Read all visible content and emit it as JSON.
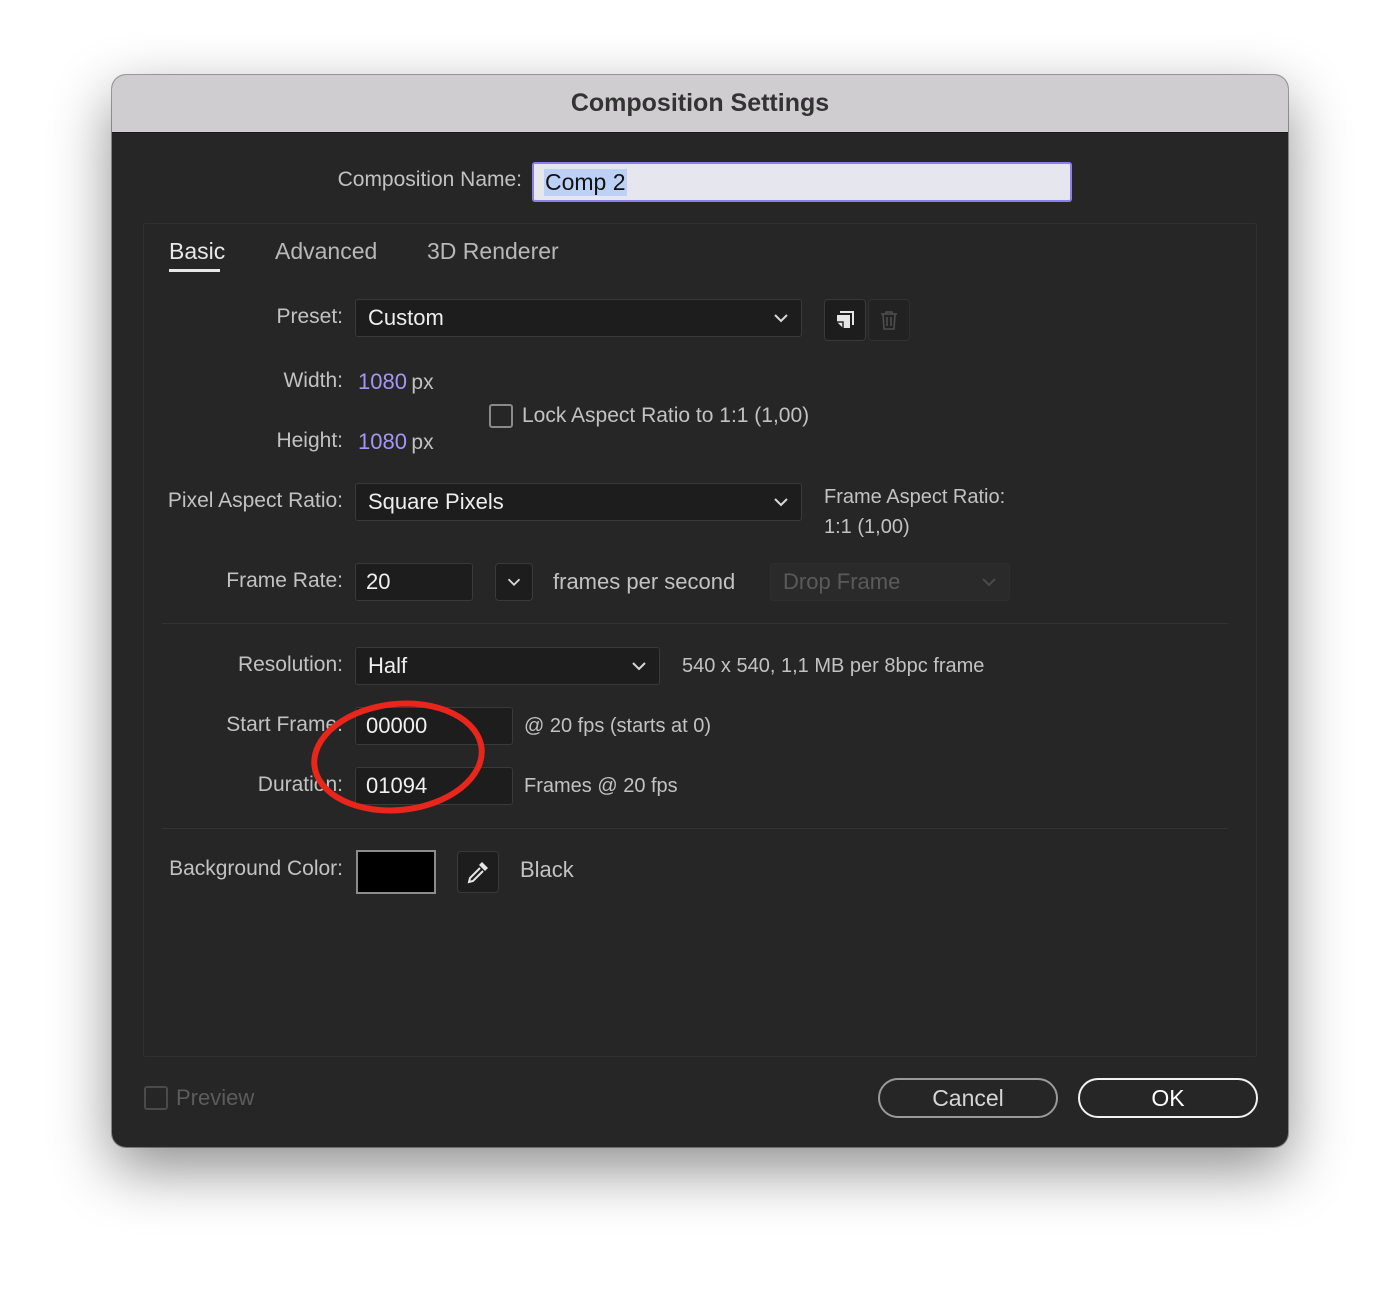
{
  "window": {
    "title": "Composition Settings"
  },
  "composition_name": {
    "label": "Composition Name:",
    "value": "Comp 2"
  },
  "tabs": [
    {
      "label": "Basic",
      "active": true
    },
    {
      "label": "Advanced",
      "active": false
    },
    {
      "label": "3D Renderer",
      "active": false
    }
  ],
  "preset": {
    "label": "Preset:",
    "value": "Custom",
    "save_icon": "save-preset-icon",
    "delete_icon": "trash-icon"
  },
  "width": {
    "label": "Width:",
    "value": "1080",
    "unit": "px"
  },
  "height": {
    "label": "Height:",
    "value": "1080",
    "unit": "px"
  },
  "lock_aspect": {
    "label": "Lock Aspect Ratio to 1:1 (1,00)",
    "checked": false
  },
  "pixel_aspect": {
    "label": "Pixel Aspect Ratio:",
    "value": "Square Pixels"
  },
  "frame_aspect": {
    "label": "Frame Aspect Ratio:",
    "value": "1:1 (1,00)"
  },
  "frame_rate": {
    "label": "Frame Rate:",
    "value": "20",
    "unit": "frames per second",
    "drop_frame": "Drop Frame"
  },
  "resolution": {
    "label": "Resolution:",
    "value": "Half",
    "info": "540 x 540, 1,1 MB per 8bpc frame"
  },
  "start_frame": {
    "label": "Start Frame:",
    "value": "00000",
    "info": "@ 20 fps (starts at 0)"
  },
  "duration": {
    "label": "Duration:",
    "value": "01094",
    "info": "Frames @ 20 fps"
  },
  "background": {
    "label": "Background Color:",
    "color": "#000000",
    "name": "Black",
    "icon": "eyedropper-icon"
  },
  "footer": {
    "preview_label": "Preview",
    "preview_checked": false,
    "cancel_label": "Cancel",
    "ok_label": "OK"
  },
  "colors": {
    "accent": "#a596f5",
    "focus_border": "#8b7ff0",
    "annotation": "#e8261b",
    "dialog_bg": "#262626"
  }
}
